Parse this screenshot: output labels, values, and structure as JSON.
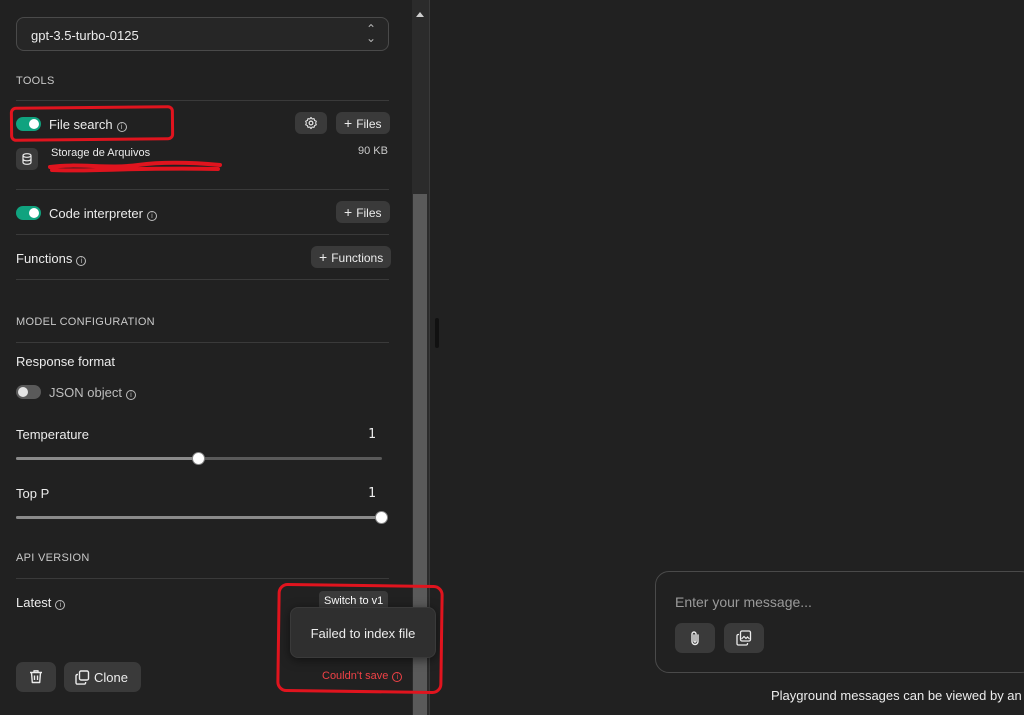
{
  "model": {
    "selected": "gpt-3.5-turbo-0125"
  },
  "tools": {
    "title": "TOOLS",
    "file_search": {
      "label": "File search",
      "enabled": true,
      "files_button": "Files"
    },
    "file": {
      "name": "Storage de Arquivos",
      "size": "90 KB"
    },
    "code_interpreter": {
      "label": "Code interpreter",
      "enabled": true,
      "files_button": "Files"
    },
    "functions": {
      "label": "Functions",
      "button": "Functions"
    }
  },
  "model_config": {
    "title": "MODEL CONFIGURATION",
    "response_format": {
      "label": "Response format",
      "json_label": "JSON object",
      "json_enabled": false
    },
    "temperature": {
      "label": "Temperature",
      "value": "1",
      "fraction": 0.5
    },
    "top_p": {
      "label": "Top P",
      "value": "1",
      "fraction": 1.0
    }
  },
  "api_version": {
    "title": "API VERSION",
    "label": "Latest",
    "switch_tooltip": "Switch to v1"
  },
  "actions": {
    "clone_label": "Clone"
  },
  "toast": {
    "message": "Failed to index file"
  },
  "save_status": {
    "error": "Couldn't save"
  },
  "composer": {
    "placeholder": "Enter your message..."
  },
  "footer": {
    "note": "Playground messages can be viewed by an"
  },
  "colors": {
    "toggle_on": "#10a37f",
    "error": "#ef4146",
    "annotation": "#e0141e"
  }
}
